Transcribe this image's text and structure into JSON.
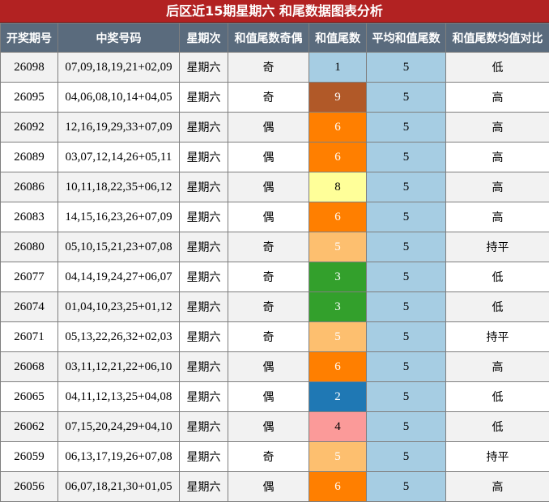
{
  "title": "后区近15期星期六 和尾数据图表分析",
  "headers": [
    "开奖期号",
    "中奖号码",
    "星期次",
    "和值尾数奇偶",
    "和值尾数",
    "平均和值尾数",
    "和值尾数均值对比"
  ],
  "colors": {
    "title_bg": "#b22222",
    "header_bg": "#5a6b7d",
    "avg_bg": "#a6cde3",
    "tail_1": "#a6cde3",
    "tail_2": "#1f78b4",
    "tail_3": "#33a02c",
    "tail_4": "#fb9a99",
    "tail_5": "#fdbf6f",
    "tail_6": "#ff7f00",
    "tail_8": "#ffff99",
    "tail_9": "#b15928"
  },
  "rows": [
    {
      "issue": "26098",
      "numbers": "07,09,18,19,21+02,09",
      "weekday": "星期六",
      "parity": "奇",
      "tail": "1",
      "avg": "5",
      "compare": "低"
    },
    {
      "issue": "26095",
      "numbers": "04,06,08,10,14+04,05",
      "weekday": "星期六",
      "parity": "奇",
      "tail": "9",
      "avg": "5",
      "compare": "高"
    },
    {
      "issue": "26092",
      "numbers": "12,16,19,29,33+07,09",
      "weekday": "星期六",
      "parity": "偶",
      "tail": "6",
      "avg": "5",
      "compare": "高"
    },
    {
      "issue": "26089",
      "numbers": "03,07,12,14,26+05,11",
      "weekday": "星期六",
      "parity": "偶",
      "tail": "6",
      "avg": "5",
      "compare": "高"
    },
    {
      "issue": "26086",
      "numbers": "10,11,18,22,35+06,12",
      "weekday": "星期六",
      "parity": "偶",
      "tail": "8",
      "avg": "5",
      "compare": "高"
    },
    {
      "issue": "26083",
      "numbers": "14,15,16,23,26+07,09",
      "weekday": "星期六",
      "parity": "偶",
      "tail": "6",
      "avg": "5",
      "compare": "高"
    },
    {
      "issue": "26080",
      "numbers": "05,10,15,21,23+07,08",
      "weekday": "星期六",
      "parity": "奇",
      "tail": "5",
      "avg": "5",
      "compare": "持平"
    },
    {
      "issue": "26077",
      "numbers": "04,14,19,24,27+06,07",
      "weekday": "星期六",
      "parity": "奇",
      "tail": "3",
      "avg": "5",
      "compare": "低"
    },
    {
      "issue": "26074",
      "numbers": "01,04,10,23,25+01,12",
      "weekday": "星期六",
      "parity": "奇",
      "tail": "3",
      "avg": "5",
      "compare": "低"
    },
    {
      "issue": "26071",
      "numbers": "05,13,22,26,32+02,03",
      "weekday": "星期六",
      "parity": "奇",
      "tail": "5",
      "avg": "5",
      "compare": "持平"
    },
    {
      "issue": "26068",
      "numbers": "03,11,12,21,22+06,10",
      "weekday": "星期六",
      "parity": "偶",
      "tail": "6",
      "avg": "5",
      "compare": "高"
    },
    {
      "issue": "26065",
      "numbers": "04,11,12,13,25+04,08",
      "weekday": "星期六",
      "parity": "偶",
      "tail": "2",
      "avg": "5",
      "compare": "低"
    },
    {
      "issue": "26062",
      "numbers": "07,15,20,24,29+04,10",
      "weekday": "星期六",
      "parity": "偶",
      "tail": "4",
      "avg": "5",
      "compare": "低"
    },
    {
      "issue": "26059",
      "numbers": "06,13,17,19,26+07,08",
      "weekday": "星期六",
      "parity": "奇",
      "tail": "5",
      "avg": "5",
      "compare": "持平"
    },
    {
      "issue": "26056",
      "numbers": "06,07,18,21,30+01,05",
      "weekday": "星期六",
      "parity": "偶",
      "tail": "6",
      "avg": "5",
      "compare": "高"
    }
  ]
}
